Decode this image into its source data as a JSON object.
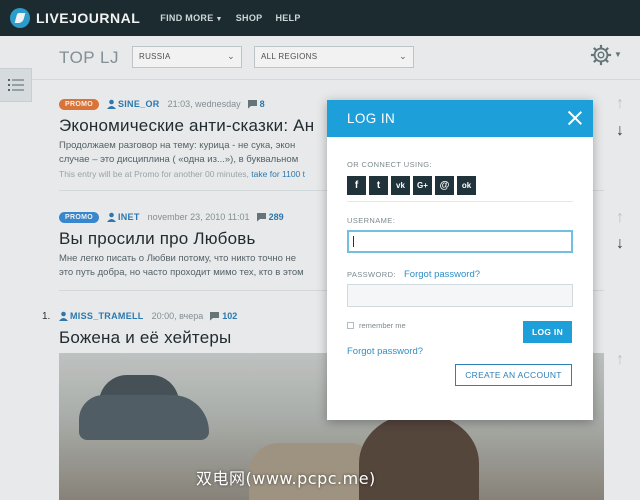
{
  "header": {
    "logo_text": "LIVEJOURNAL",
    "nav": [
      {
        "label": "FIND MORE",
        "has_caret": true
      },
      {
        "label": "SHOP"
      },
      {
        "label": "HELP"
      }
    ]
  },
  "toolbar": {
    "title": "TOP LJ",
    "country_select": "RUSSIA",
    "region_select": "ALL REGIONS"
  },
  "posts": [
    {
      "badge": "PROMO",
      "user": "SINE_OR",
      "date": "21:03, wednesday",
      "comments": "8",
      "title": "Экономические анти-сказки: Ан",
      "body_1": "Продолжаем разговор на тему: курица - не сука, экон",
      "body_2": "случае – это дисциплина ( «одна из...»), в буквальном",
      "note_prefix": "This entry will be at Promo for another 00 minutes,",
      "note_link": "take for 1100 t"
    },
    {
      "badge": "PROMO",
      "user": "INET",
      "date": "november 23, 2010 11:01",
      "comments": "289",
      "title": "Вы просили про Любовь",
      "body_1": "Мне легко писать о Любви потому, что никто точно не",
      "body_2": "это путь добра, но часто проходит мимо тех, кто в этом"
    },
    {
      "number": "1.",
      "user": "MISS_TRAMELL",
      "date": "20:00, вчера",
      "comments": "102",
      "title": "Божена и её хейтеры"
    }
  ],
  "login_modal": {
    "title": "LOG IN",
    "connect_label": "OR CONNECT USING:",
    "social": [
      {
        "icon": "facebook-icon",
        "glyph": "f"
      },
      {
        "icon": "twitter-icon",
        "glyph": "t"
      },
      {
        "icon": "vk-icon",
        "glyph": "vk"
      },
      {
        "icon": "google-plus-icon",
        "glyph": "G+"
      },
      {
        "icon": "mail-icon",
        "glyph": "@"
      },
      {
        "icon": "odnoklassniki-icon",
        "glyph": "ok"
      }
    ],
    "username_label": "USERNAME:",
    "username_value": "",
    "password_label": "PASSWORD:",
    "forgot_inline": "Forgot password?",
    "remember_label": "remember me",
    "login_button": "LOG IN",
    "forgot_link": "Forgot password?",
    "create_button": "CREATE AN ACCOUNT"
  },
  "watermark": "双电网(www.pcpc.me)",
  "colors": {
    "header_bg": "#1e2e33",
    "accent_blue": "#1d9fda",
    "promo_orange": "#e67a3a",
    "promo_blue": "#3b8ed9",
    "link": "#2f7fb7"
  }
}
